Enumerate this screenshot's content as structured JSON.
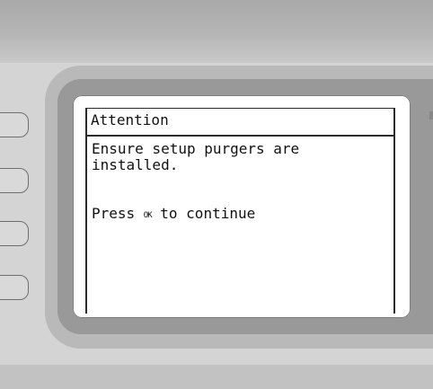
{
  "dialog": {
    "title": "Attention",
    "message": "Ensure setup purgers are\ninstalled.",
    "prompt_before": "Press ",
    "prompt_key": "OK",
    "prompt_after": " to continue"
  },
  "soft_keys": [
    {
      "name": "soft-key-1"
    },
    {
      "name": "soft-key-2"
    },
    {
      "name": "soft-key-3"
    },
    {
      "name": "soft-key-4"
    }
  ]
}
